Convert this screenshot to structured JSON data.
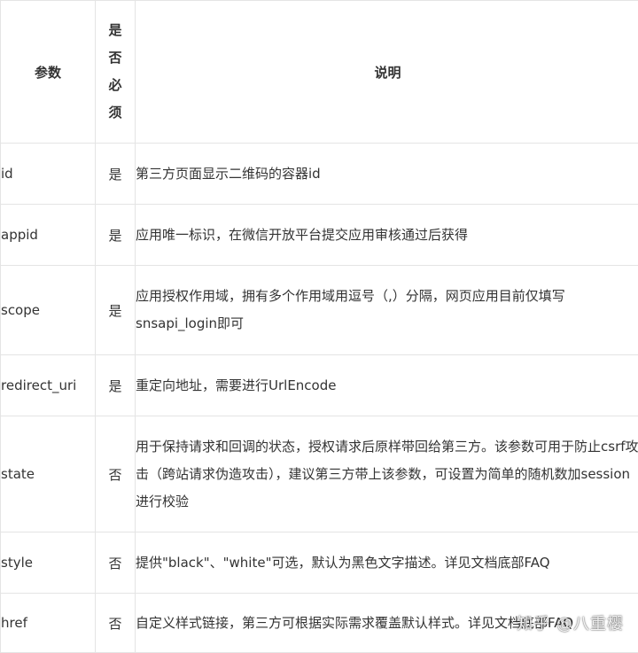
{
  "table": {
    "headers": {
      "param": "参数",
      "required": "是否必须",
      "description": "说明"
    },
    "rows": [
      {
        "param": "id",
        "required": "是",
        "description": "第三方页面显示二维码的容器id"
      },
      {
        "param": "appid",
        "required": "是",
        "description": "应用唯一标识，在微信开放平台提交应用审核通过后获得"
      },
      {
        "param": "scope",
        "required": "是",
        "description": "应用授权作用域，拥有多个作用域用逗号（,）分隔，网页应用目前仅填写snsapi_login即可"
      },
      {
        "param": "redirect_uri",
        "required": "是",
        "description": "重定向地址，需要进行UrlEncode"
      },
      {
        "param": "state",
        "required": "否",
        "description": "用于保持请求和回调的状态，授权请求后原样带回给第三方。该参数可用于防止csrf攻击（跨站请求伪造攻击），建议第三方带上该参数，可设置为简单的随机数加session进行校验"
      },
      {
        "param": "style",
        "required": "否",
        "description": "提供\"black\"、\"white\"可选，默认为黑色文字描述。详见文档底部FAQ"
      },
      {
        "param": "href",
        "required": "否",
        "description": "自定义样式链接，第三方可根据实际需求覆盖默认样式。详见文档底部FAQ"
      }
    ]
  },
  "watermark": "知乎 @八重樱"
}
